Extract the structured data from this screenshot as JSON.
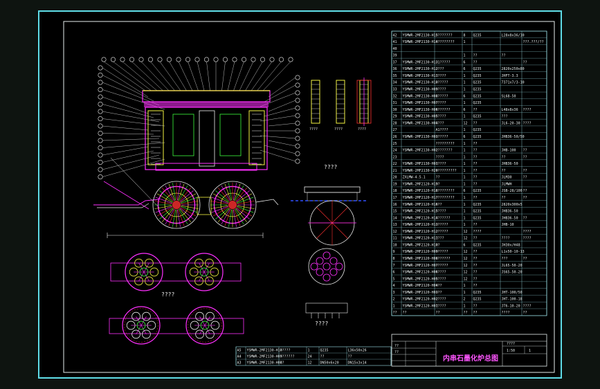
{
  "colors": {
    "background": "#0e1410",
    "frame": "#5fdde8",
    "drawing_bg": "#000000",
    "table_line": "#9ee6ee",
    "table_text": "#e8f0f0",
    "title_text": "#ff55ff",
    "magenta": "#ff30ff",
    "yellow": "#f5f542",
    "green": "#3cff3c",
    "white": "#f0f0f0",
    "red": "#ff3030",
    "blue": "#3050ff"
  },
  "labels": {
    "front_view": "????",
    "bottom_view": "????",
    "lower_plan": "????",
    "small_section": "????",
    "side_view_1": "????",
    "side_view_2": "????",
    "side_view_3": "????"
  },
  "bom": {
    "rows": [
      {
        "no": "42",
        "code": "YSMWR-2MF2130-H15",
        "name": "????????",
        "qty": "8",
        "mat": "Q235",
        "note": "L28x8x36/10",
        "extra": ""
      },
      {
        "no": "41",
        "code": "YSMWR-2MF2130-H14",
        "name": "?????????",
        "qty": "1",
        "mat": "",
        "note": "",
        "extra": "???.???/??"
      },
      {
        "no": "40",
        "code": "",
        "name": "",
        "qty": "",
        "mat": "",
        "note": "",
        "extra": ""
      },
      {
        "no": "39",
        "code": "",
        "name": "",
        "qty": "1",
        "mat": "??",
        "note": "??",
        "extra": ""
      },
      {
        "no": "37",
        "code": "YSMWR-2MF2130-H13",
        "name": "?1?????",
        "qty": "6",
        "mat": "??",
        "note": "",
        "extra": "??"
      },
      {
        "no": "36",
        "code": "YSMWR-2MF2130-H12",
        "name": "????",
        "qty": "6",
        "mat": "Q235",
        "note": "2820x250x80",
        "extra": ""
      },
      {
        "no": "35",
        "code": "YSMWR-2MF2130-H11",
        "name": "?????",
        "qty": "1",
        "mat": "Q235",
        "note": "JHFT-3.3",
        "extra": ""
      },
      {
        "no": "34",
        "code": "YSMWR-2MF2130-H10",
        "name": "??????",
        "qty": "1",
        "mat": "Q235",
        "note": "7371x7/3-10",
        "extra": ""
      },
      {
        "no": "33",
        "code": "YSMWR-2MF2130-H09",
        "name": "?????",
        "qty": "1",
        "mat": "Q235",
        "note": "",
        "extra": ""
      },
      {
        "no": "32",
        "code": "YSMWR-2MF2130-H08",
        "name": "??????",
        "qty": "6",
        "mat": "Q235",
        "note": "SL68-50",
        "extra": ""
      },
      {
        "no": "31",
        "code": "YSMWR-2MF2130-H07",
        "name": "?????",
        "qty": "1",
        "mat": "Q235",
        "note": "",
        "extra": ""
      },
      {
        "no": "30",
        "code": "YSMWR-2MF2130-H06",
        "name": "???????",
        "qty": "6",
        "mat": "??",
        "note": "L48x8x36",
        "extra": "????"
      },
      {
        "no": "29",
        "code": "YSMWR-2MF2130-H05",
        "name": "?????",
        "qty": "1",
        "mat": "Q235",
        "note": "???",
        "extra": ""
      },
      {
        "no": "28",
        "code": "YSMWR-2MF2130-H04",
        "name": "????",
        "qty": "12",
        "mat": "??",
        "note": "JL6-20-30",
        "extra": "????"
      },
      {
        "no": "27",
        "code": "",
        "name": "A1????",
        "qty": "1",
        "mat": "Q235",
        "note": "",
        "extra": ""
      },
      {
        "no": "26",
        "code": "YSMWR-2MF2130-H03",
        "name": "??????",
        "qty": "6",
        "mat": "Q235",
        "note": "JHB36-50/50",
        "extra": ""
      },
      {
        "no": "25",
        "code": "",
        "name": "?????????",
        "qty": "1",
        "mat": "??",
        "note": "",
        "extra": ""
      },
      {
        "no": "24",
        "code": "YSMWR-2MF2130-H02",
        "name": "????????",
        "qty": "1",
        "mat": "??",
        "note": "JHB-100",
        "extra": "??"
      },
      {
        "no": "23",
        "code": "",
        "name": "????",
        "qty": "1",
        "mat": "??",
        "note": "??",
        "extra": "??"
      },
      {
        "no": "22",
        "code": "YSMWR-2MF2130-H01",
        "name": "?????",
        "qty": "1",
        "mat": "??",
        "note": "JHB36-50",
        "extra": ""
      },
      {
        "no": "21",
        "code": "YSMWR-2MF2130-H20",
        "name": "??????????",
        "qty": "1",
        "mat": "??",
        "note": "??",
        "extra": "??"
      },
      {
        "no": "20",
        "code": "ZXLMW-4.5.1",
        "name": "??",
        "qty": "1",
        "mat": "??",
        "note": "JLM30",
        "extra": "??"
      },
      {
        "no": "19",
        "code": "YSMWR-2MF2120-H19",
        "name": "??",
        "qty": "1",
        "mat": "??",
        "note": "JLMWH",
        "extra": ""
      },
      {
        "no": "18",
        "code": "YSMWR-2MF2120-H18",
        "name": "?????????",
        "qty": "6",
        "mat": "Q235",
        "note": "JSB-28/100",
        "extra": "??"
      },
      {
        "no": "17",
        "code": "YSMWR-2MF2120-H17",
        "name": "?????????",
        "qty": "1",
        "mat": "??",
        "note": "??",
        "extra": "??"
      },
      {
        "no": "16",
        "code": "YSMWR-2MF2120-H16",
        "name": "???",
        "qty": "1",
        "mat": "Q235",
        "note": "2820x300x5",
        "extra": ""
      },
      {
        "no": "15",
        "code": "YSMWR-2MF2120-H15",
        "name": "?????",
        "qty": "1",
        "mat": "Q235",
        "note": "JHB36-50",
        "extra": ""
      },
      {
        "no": "14",
        "code": "YSMWR-2MF2120-H14",
        "name": "???????",
        "qty": "1",
        "mat": "Q235",
        "note": "JHB36-50",
        "extra": "??"
      },
      {
        "no": "13",
        "code": "YSMWR-2MF2120-H13",
        "name": "??????",
        "qty": "1",
        "mat": "??",
        "note": "JHB-10",
        "extra": ""
      },
      {
        "no": "12",
        "code": "YSMWR-2MF2120-H12",
        "name": "??????",
        "qty": "12",
        "mat": "????",
        "note": "",
        "extra": "????"
      },
      {
        "no": "11",
        "code": "YSMWR-2MF2120-H11",
        "name": "????",
        "qty": "12",
        "mat": "??",
        "note": "????",
        "extra": "????"
      },
      {
        "no": "10",
        "code": "YSMWR-2MF2120-H10",
        "name": "??",
        "qty": "6",
        "mat": "Q235",
        "note": "JH30x/H48",
        "extra": ""
      },
      {
        "no": "9",
        "code": "YSMWR-2MF2120-H09",
        "name": "??????",
        "qty": "12",
        "mat": "??",
        "note": "L1x50-10-13",
        "extra": ""
      },
      {
        "no": "8",
        "code": "YSMWR-2MF2120-H08",
        "name": "???????",
        "qty": "12",
        "mat": "??",
        "note": "???",
        "extra": "??"
      },
      {
        "no": "7",
        "code": "YSMWR-2MF2120-H07",
        "name": "??????",
        "qty": "12",
        "mat": "??",
        "note": "JL65-50-20",
        "extra": ""
      },
      {
        "no": "6",
        "code": "YSMWR-2MF2120-H06",
        "name": "?????",
        "qty": "12",
        "mat": "??",
        "note": "JS65-50-20",
        "extra": ""
      },
      {
        "no": "5",
        "code": "YSMWR-2MF2120-H05",
        "name": "?????",
        "qty": "12",
        "mat": "??",
        "note": "",
        "extra": ""
      },
      {
        "no": "4",
        "code": "YSMWR-2MF2120-H04",
        "name": "???",
        "qty": "1",
        "mat": "??",
        "note": "",
        "extra": ""
      },
      {
        "no": "3",
        "code": "YSMWR-2MF2120-H03",
        "name": "???",
        "qty": "1",
        "mat": "Q235",
        "note": "JHT-100/50",
        "extra": ""
      },
      {
        "no": "2",
        "code": "YSMWR-2MF2120-H02",
        "name": "?????",
        "qty": "2",
        "mat": "Q235",
        "note": "JHT-100-18",
        "extra": ""
      },
      {
        "no": "1",
        "code": "YSMWR-2MF2120-H01",
        "name": "?????",
        "qty": "1",
        "mat": "??",
        "note": "JT6-10-20",
        "extra": "????"
      }
    ],
    "header": {
      "no": "??",
      "code": "??",
      "name": "??",
      "qty": "??",
      "mat": "??",
      "note": "????",
      "extra": "??"
    }
  },
  "lower_table": {
    "rows": [
      {
        "no": "A5",
        "code": "YSMWR-2MF2130-H10",
        "name": "?????",
        "qty": "1",
        "mat": "Q235",
        "note": "L36x50x26"
      },
      {
        "no": "A4",
        "code": "YSMWR-2MF2130-H09",
        "name": "???????",
        "qty": "24",
        "mat": "??",
        "note": "??"
      },
      {
        "no": "A3",
        "code": "YSMWR-2MF2130-H08",
        "name": "??",
        "qty": "12",
        "mat": "DN50x6x20",
        "note": "DN15x3x14"
      }
    ]
  },
  "title_block": {
    "drawing_title": "内串石墨化炉总图",
    "scale": "1:50",
    "sheet": "1",
    "label_a": "????",
    "label_b": "??",
    "label_c": "??"
  }
}
